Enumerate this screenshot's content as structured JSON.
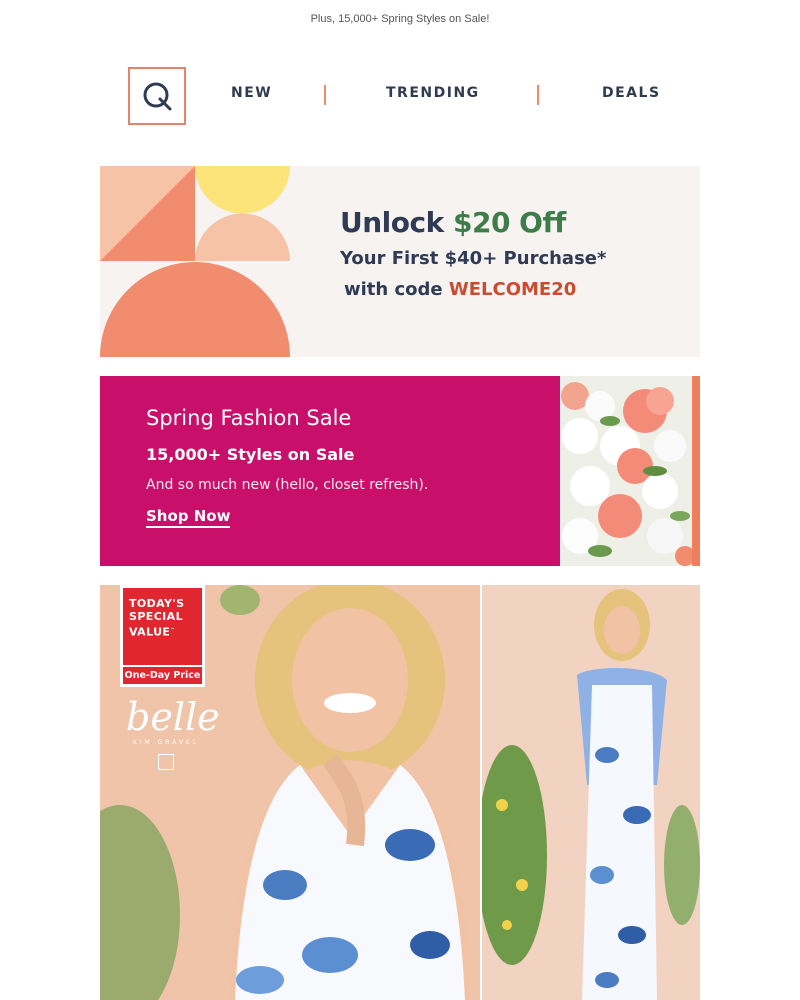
{
  "preheader": {
    "text": "Plus, 15,000+ Spring Styles on Sale!"
  },
  "nav": {
    "logo_icon": "qvc-q-logo-icon",
    "items": [
      {
        "label": "NEW"
      },
      {
        "label": "TRENDING"
      },
      {
        "label": "DEALS"
      }
    ]
  },
  "promo": {
    "line1_prefix": "Unlock ",
    "line1_amount": "$20 Off",
    "line2": "Your First $40+ Purchase*",
    "line3_prefix": "with code ",
    "line3_code": "WELCOME20"
  },
  "sale": {
    "title": "Spring Fashion Sale",
    "subtitle": "15,000+ Styles on Sale",
    "description": "And so much new (hello, closet refresh).",
    "cta": "Shop Now",
    "image_icon": "flower-bouquet-photo"
  },
  "hero": {
    "badge_line1": "TODAY'S",
    "badge_line2": "SPECIAL",
    "badge_line3": "VALUE",
    "badge_tm": "™",
    "badge_sub": "One-Day Price",
    "brand_name": "belle",
    "brand_sub": "KIM GRAVEL",
    "brand_icon": "belle-monogram-icon"
  },
  "colors": {
    "accent_orange": "#e8816a",
    "nav_text": "#2f3b4f",
    "promo_green": "#3e7d4a",
    "promo_code": "#cc4b2f",
    "sale_magenta": "#c8106a",
    "tsv_red": "#e0262e"
  }
}
